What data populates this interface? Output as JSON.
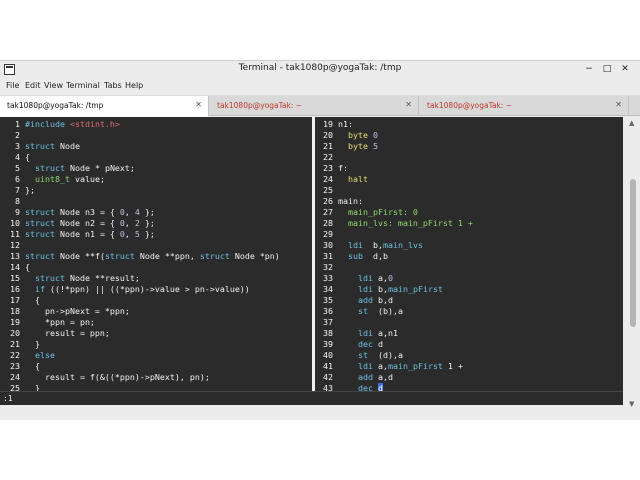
{
  "window": {
    "title": "Terminal - tak1080p@yogaTak: /tmp",
    "controls": {
      "minimize": "−",
      "maximize": "□",
      "close": "✕"
    }
  },
  "menu": [
    "File",
    "Edit",
    "View",
    "Terminal",
    "Tabs",
    "Help"
  ],
  "tabs": [
    {
      "label": "tak1080p@yogaTak: /tmp",
      "close": "✕",
      "active": true
    },
    {
      "label": "tak1080p@yogaTak: ~",
      "close": "✕",
      "active": false
    },
    {
      "label": "tak1080p@yogaTak: ~",
      "close": "✕",
      "active": false
    }
  ],
  "status": {
    "command_line": ":1"
  },
  "icons": {
    "app": "terminal-icon",
    "scroll_up": "▲",
    "scroll_down": "▼"
  },
  "colors": {
    "editor_bg": "#2b2b2b",
    "keyword": "#6cc0e0",
    "string": "#e06c75",
    "number": "#c9b6e4",
    "type": "#8fd86b",
    "label": "#e6db74",
    "cursor": "#3b6ce0"
  },
  "left_pane": {
    "lines": [
      {
        "n": "1",
        "segs": [
          [
            "kw",
            "#include "
          ],
          [
            "str",
            "<stdint.h>"
          ]
        ]
      },
      {
        "n": "2",
        "segs": []
      },
      {
        "n": "3",
        "segs": [
          [
            "kw",
            "struct"
          ],
          [
            "txt",
            " Node"
          ]
        ]
      },
      {
        "n": "4",
        "segs": [
          [
            "txt",
            "{"
          ]
        ]
      },
      {
        "n": "5",
        "segs": [
          [
            "txt",
            "  "
          ],
          [
            "kw",
            "struct"
          ],
          [
            "txt",
            " Node * pNext;"
          ]
        ]
      },
      {
        "n": "6",
        "segs": [
          [
            "txt",
            "  "
          ],
          [
            "ty",
            "uint8_t"
          ],
          [
            "txt",
            " value;"
          ]
        ]
      },
      {
        "n": "7",
        "segs": [
          [
            "txt",
            "};"
          ]
        ]
      },
      {
        "n": "8",
        "segs": []
      },
      {
        "n": "9",
        "segs": [
          [
            "kw",
            "struct"
          ],
          [
            "txt",
            " Node n3 = { "
          ],
          [
            "num",
            "0"
          ],
          [
            "txt",
            ", "
          ],
          [
            "num",
            "4"
          ],
          [
            "txt",
            " };"
          ]
        ]
      },
      {
        "n": "10",
        "segs": [
          [
            "kw",
            "struct"
          ],
          [
            "txt",
            " Node n2 = { "
          ],
          [
            "num",
            "0"
          ],
          [
            "txt",
            ", "
          ],
          [
            "num",
            "2"
          ],
          [
            "txt",
            " };"
          ]
        ]
      },
      {
        "n": "11",
        "segs": [
          [
            "kw",
            "struct"
          ],
          [
            "txt",
            " Node n1 = { "
          ],
          [
            "num",
            "0"
          ],
          [
            "txt",
            ", "
          ],
          [
            "num",
            "5"
          ],
          [
            "txt",
            " };"
          ]
        ]
      },
      {
        "n": "12",
        "segs": []
      },
      {
        "n": "13",
        "segs": [
          [
            "kw",
            "struct"
          ],
          [
            "txt",
            " Node **f("
          ],
          [
            "kw",
            "struct"
          ],
          [
            "txt",
            " Node **ppn, "
          ],
          [
            "kw",
            "struct"
          ],
          [
            "txt",
            " Node *pn)"
          ]
        ]
      },
      {
        "n": "14",
        "segs": [
          [
            "txt",
            "{"
          ]
        ]
      },
      {
        "n": "15",
        "segs": [
          [
            "txt",
            "  "
          ],
          [
            "kw",
            "struct"
          ],
          [
            "txt",
            " Node **result;"
          ]
        ]
      },
      {
        "n": "16",
        "segs": [
          [
            "txt",
            "  "
          ],
          [
            "kw",
            "if"
          ],
          [
            "txt",
            " ((!*ppn) || ((*ppn)->value > pn->value))"
          ]
        ]
      },
      {
        "n": "17",
        "segs": [
          [
            "txt",
            "  {"
          ]
        ]
      },
      {
        "n": "18",
        "segs": [
          [
            "txt",
            "    pn->pNext = *ppn;"
          ]
        ]
      },
      {
        "n": "19",
        "segs": [
          [
            "txt",
            "    *ppn = pn;"
          ]
        ]
      },
      {
        "n": "20",
        "segs": [
          [
            "txt",
            "    result = ppn;"
          ]
        ]
      },
      {
        "n": "21",
        "segs": [
          [
            "txt",
            "  }"
          ]
        ]
      },
      {
        "n": "22",
        "segs": [
          [
            "txt",
            "  "
          ],
          [
            "kw",
            "else"
          ]
        ]
      },
      {
        "n": "23",
        "segs": [
          [
            "txt",
            "  {"
          ]
        ]
      },
      {
        "n": "24",
        "segs": [
          [
            "txt",
            "    result = f(&((*ppn)->pNext), pn);"
          ]
        ]
      },
      {
        "n": "25",
        "segs": [
          [
            "txt",
            "  }"
          ]
        ]
      }
    ]
  },
  "right_pane": {
    "lines": [
      {
        "n": "19",
        "segs": [
          [
            "txt",
            "n1:"
          ]
        ]
      },
      {
        "n": "20",
        "segs": [
          [
            "txt",
            "  "
          ],
          [
            "lbl",
            "byte"
          ],
          [
            "txt",
            " "
          ],
          [
            "num",
            "0"
          ]
        ]
      },
      {
        "n": "21",
        "segs": [
          [
            "txt",
            "  "
          ],
          [
            "lbl",
            "byte"
          ],
          [
            "txt",
            " "
          ],
          [
            "num",
            "5"
          ]
        ]
      },
      {
        "n": "22",
        "segs": []
      },
      {
        "n": "23",
        "segs": [
          [
            "txt",
            "f:"
          ]
        ]
      },
      {
        "n": "24",
        "segs": [
          [
            "txt",
            "  "
          ],
          [
            "lbl",
            "halt"
          ]
        ]
      },
      {
        "n": "25",
        "segs": []
      },
      {
        "n": "26",
        "segs": [
          [
            "txt",
            "main:"
          ]
        ]
      },
      {
        "n": "27",
        "segs": [
          [
            "txt",
            "  "
          ],
          [
            "ty",
            "main_pFirst: 0"
          ]
        ]
      },
      {
        "n": "28",
        "segs": [
          [
            "txt",
            "  "
          ],
          [
            "ty",
            "main_lvs: main_pFirst 1 +"
          ]
        ]
      },
      {
        "n": "29",
        "segs": []
      },
      {
        "n": "30",
        "segs": [
          [
            "txt",
            "  "
          ],
          [
            "kw",
            "ldi"
          ],
          [
            "txt",
            "  b,"
          ],
          [
            "kw",
            "main_lvs"
          ]
        ]
      },
      {
        "n": "31",
        "segs": [
          [
            "txt",
            "  "
          ],
          [
            "kw",
            "sub"
          ],
          [
            "txt",
            "  d,b"
          ]
        ]
      },
      {
        "n": "32",
        "segs": []
      },
      {
        "n": "33",
        "segs": [
          [
            "txt",
            "    "
          ],
          [
            "kw",
            "ldi"
          ],
          [
            "txt",
            " a,"
          ],
          [
            "num",
            "0"
          ]
        ]
      },
      {
        "n": "34",
        "segs": [
          [
            "txt",
            "    "
          ],
          [
            "kw",
            "ldi"
          ],
          [
            "txt",
            " b,"
          ],
          [
            "kw",
            "main_pFirst"
          ]
        ]
      },
      {
        "n": "35",
        "segs": [
          [
            "txt",
            "    "
          ],
          [
            "kw",
            "add"
          ],
          [
            "txt",
            " b,d"
          ]
        ]
      },
      {
        "n": "36",
        "segs": [
          [
            "txt",
            "    "
          ],
          [
            "kw",
            "st"
          ],
          [
            "txt",
            "  (b),a"
          ]
        ]
      },
      {
        "n": "37",
        "segs": []
      },
      {
        "n": "38",
        "segs": [
          [
            "txt",
            "    "
          ],
          [
            "kw",
            "ldi"
          ],
          [
            "txt",
            " a,n1"
          ]
        ]
      },
      {
        "n": "39",
        "segs": [
          [
            "txt",
            "    "
          ],
          [
            "kw",
            "dec"
          ],
          [
            "txt",
            " d"
          ]
        ]
      },
      {
        "n": "40",
        "segs": [
          [
            "txt",
            "    "
          ],
          [
            "kw",
            "st"
          ],
          [
            "txt",
            "  (d),a"
          ]
        ]
      },
      {
        "n": "41",
        "segs": [
          [
            "txt",
            "    "
          ],
          [
            "kw",
            "ldi"
          ],
          [
            "txt",
            " a,"
          ],
          [
            "kw",
            "main_pFirst"
          ],
          [
            "txt",
            " 1 +"
          ]
        ]
      },
      {
        "n": "42",
        "segs": [
          [
            "txt",
            "    "
          ],
          [
            "kw",
            "add"
          ],
          [
            "txt",
            " a,d"
          ]
        ]
      },
      {
        "n": "43",
        "segs": [
          [
            "txt",
            "    "
          ],
          [
            "kw",
            "dec"
          ],
          [
            "txt",
            " "
          ],
          [
            "cursor",
            "d"
          ]
        ]
      }
    ]
  }
}
